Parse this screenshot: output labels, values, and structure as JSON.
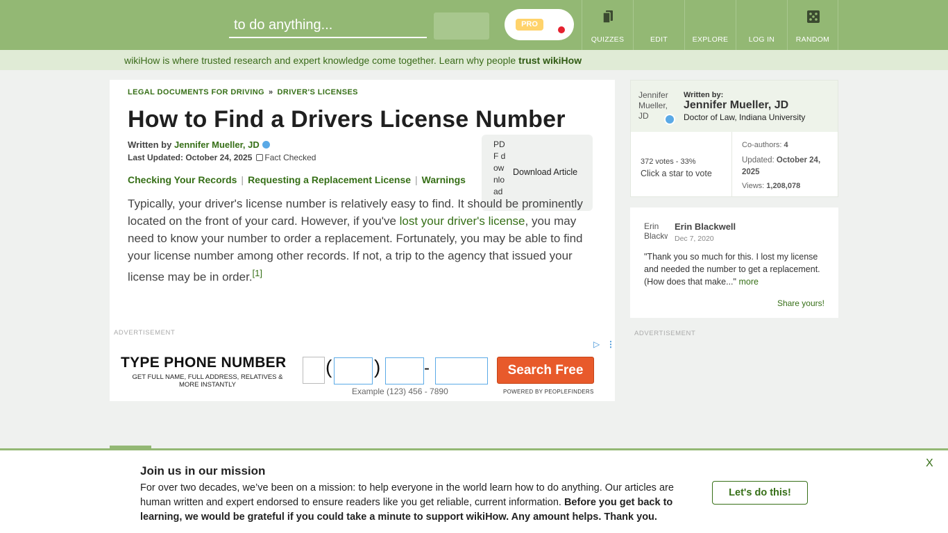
{
  "header": {
    "search_placeholder": "to do anything...",
    "pro_badge": "PRO",
    "nav": [
      {
        "label": "QUIZZES",
        "icon": "quizzes-icon"
      },
      {
        "label": "EDIT",
        "icon": "edit-icon"
      },
      {
        "label": "EXPLORE",
        "icon": "explore-icon"
      },
      {
        "label": "LOG IN",
        "icon": "login-icon"
      },
      {
        "label": "RANDOM",
        "icon": "dice-icon"
      }
    ]
  },
  "trust_bar": {
    "text": "wikiHow is where trusted research and expert knowledge come together. Learn why people ",
    "link": "trust wikiHow"
  },
  "article": {
    "breadcrumb": [
      "LEGAL DOCUMENTS FOR DRIVING",
      "DRIVER'S LICENSES"
    ],
    "breadcrumb_sep": "»",
    "title": "How to Find a Drivers License Number",
    "written_by": "Written by",
    "author": "Jennifer Mueller, JD",
    "last_updated": "Last Updated: October 24, 2025",
    "fact_checked": "Fact Checked",
    "toc": [
      "Checking Your Records",
      "Requesting a Replacement License",
      "Warnings"
    ],
    "download_alt": "PDF download",
    "download_label": "Download Article",
    "intro": {
      "part1": "Typically, your driver's license number is relatively easy to find. It should be prominently located on the front of your card. However, if you've ",
      "link": "lost your driver's license",
      "part2": ", you may need to know your number to order a replacement. Fortunately, you may be able to find your license number among other records. If not, a trip to the agency that issued your license may be in order.",
      "ref": "[1]"
    },
    "ad_label": "ADVERTISEMENT"
  },
  "ad": {
    "headline": "TYPE PHONE NUMBER",
    "sub": "GET FULL NAME, FULL ADDRESS, RELATIVES & MORE INSTANTLY",
    "open_paren": "(",
    "close_paren": ")",
    "dash": "-",
    "example": "Example (123) 456 - 7890",
    "cta": "Search Free",
    "powered": "POWERED BY PEOPLEFINDERS"
  },
  "sidebar": {
    "author_card": {
      "avatar_alt": "Jennifer Mueller, JD",
      "written_by": "Written by:",
      "name": "Jennifer Mueller, JD",
      "credential": "Doctor of Law, Indiana University",
      "votes": "372 votes - 33%",
      "click_star": "Click a star to vote",
      "coauthors_label": "Co-authors: ",
      "coauthors_value": "4",
      "updated_label": "Updated: ",
      "updated_value": "October 24, 2025",
      "views_label": "Views: ",
      "views_value": "1,208,078"
    },
    "review": {
      "avatar_alt": "Erin Blackwell",
      "name": "Erin Blackwell",
      "date": "Dec 7, 2020",
      "text": "\"Thank you so much for this. I lost my license and needed the number to get a replacement. (How does that make...\" ",
      "more": "more",
      "share": "Share yours!"
    },
    "ad_label": "ADVERTISEMENT"
  },
  "mission": {
    "title": "Join us in our mission",
    "body": "For over two decades, we’ve been on a mission: to help everyone in the world learn how to do anything. Our articles are human written and expert endorsed to ensure readers like you get reliable, current information. ",
    "body_bold": "Before you get back to learning, we would be grateful if you could take a minute to support wikiHow. Any amount helps. Thank you.",
    "button": "Let's do this!",
    "close": "X"
  },
  "colors": {
    "header_bg": "#93b874",
    "link_green": "#366f17",
    "cta_orange": "#e85a2b"
  }
}
